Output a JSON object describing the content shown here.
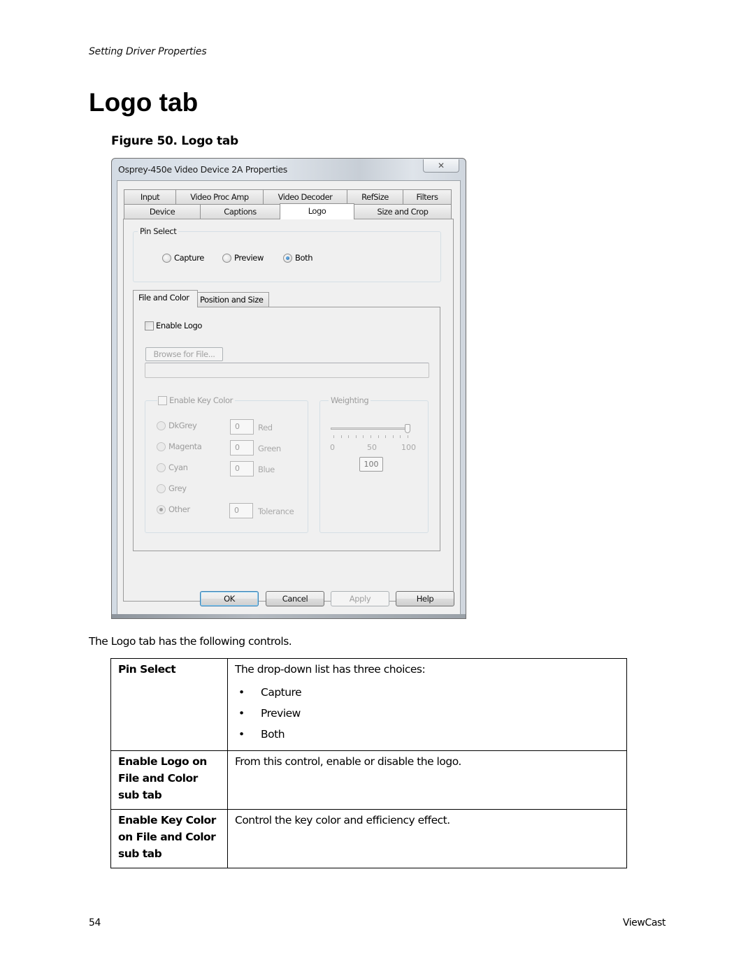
{
  "page": {
    "running_header": "Setting Driver Properties",
    "title": "Logo tab",
    "figure_caption": "Figure 50. Logo tab",
    "intro": "The Logo tab has the following controls.",
    "footer": {
      "page_number": "54",
      "brand": "ViewCast"
    }
  },
  "dialog": {
    "title": "Osprey-450e Video Device 2A Properties",
    "close_icon": "close-icon",
    "close_glyph": "✕",
    "tabs_row1": [
      {
        "label": "Input"
      },
      {
        "label": "Video Proc Amp"
      },
      {
        "label": "Video Decoder"
      },
      {
        "label": "RefSize"
      },
      {
        "label": "Filters"
      }
    ],
    "tabs_row2": [
      {
        "label": "Device"
      },
      {
        "label": "Captions"
      },
      {
        "label": "Logo",
        "active": true
      },
      {
        "label": "Size and Crop"
      }
    ],
    "pin_select": {
      "legend": "Pin Select",
      "options": [
        {
          "label": "Capture",
          "checked": false
        },
        {
          "label": "Preview",
          "checked": false
        },
        {
          "label": "Both",
          "checked": true
        }
      ]
    },
    "sub_tabs": [
      {
        "label": "File and Color",
        "active": true
      },
      {
        "label": "Position and Size",
        "active": false
      }
    ],
    "enable_logo": {
      "label": "Enable Logo",
      "checked": false
    },
    "browse_button": "Browse for File...",
    "file_path_value": "",
    "key_color": {
      "legend": "Enable Key Color",
      "checked": false,
      "options": [
        {
          "label": "DkGrey",
          "checked": false
        },
        {
          "label": "Magenta",
          "checked": false
        },
        {
          "label": "Cyan",
          "checked": false
        },
        {
          "label": "Grey",
          "checked": false
        },
        {
          "label": "Other",
          "checked": true
        }
      ],
      "fields": [
        {
          "label": "Red",
          "value": "0"
        },
        {
          "label": "Green",
          "value": "0"
        },
        {
          "label": "Blue",
          "value": "0"
        },
        {
          "label": "Tolerance",
          "value": "0"
        }
      ]
    },
    "weighting": {
      "legend": "Weighting",
      "min_label": "0",
      "mid_label": "50",
      "max_label": "100",
      "value": 100,
      "value_display": "100"
    },
    "buttons": {
      "ok": "OK",
      "cancel": "Cancel",
      "apply": "Apply",
      "help": "Help"
    }
  },
  "controls_table": [
    {
      "term": "Pin Select",
      "description": "The drop-down list has three choices:",
      "bullets": [
        "Capture",
        "Preview",
        "Both"
      ]
    },
    {
      "term": "Enable Logo on File and Color sub tab",
      "description": "From this control, enable or disable the logo.",
      "bullets": []
    },
    {
      "term": "Enable Key Color on File and Color sub tab",
      "description": "Control the key color and efficiency effect.",
      "bullets": []
    }
  ]
}
